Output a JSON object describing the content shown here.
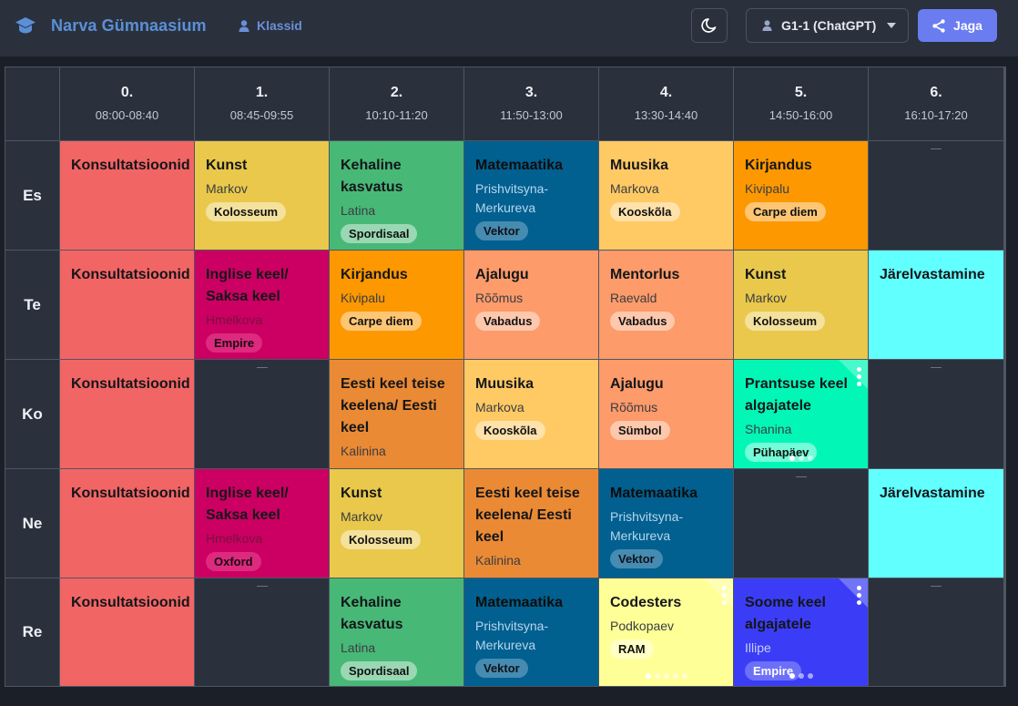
{
  "header": {
    "title": "Narva Gümnaasium",
    "classes_link": "Klassid",
    "class_select": "G1-1 (ChatGPT)",
    "share_label": "Jaga",
    "icons": [
      "school-icon",
      "user-icon",
      "moon-icon",
      "chevron-down-icon",
      "share-icon"
    ]
  },
  "periods": [
    {
      "num": "0.",
      "time": "08:00-08:40"
    },
    {
      "num": "1.",
      "time": "08:45-09:55"
    },
    {
      "num": "2.",
      "time": "10:10-11:20"
    },
    {
      "num": "3.",
      "time": "11:50-13:00"
    },
    {
      "num": "4.",
      "time": "13:30-14:40"
    },
    {
      "num": "5.",
      "time": "14:50-16:00"
    },
    {
      "num": "6.",
      "time": "16:10-17:20"
    }
  ],
  "days": [
    "Es",
    "Te",
    "Ko",
    "Ne",
    "Re"
  ],
  "colors": {
    "red": "#f26565",
    "yellow": "#e9c84b",
    "green": "#48b877",
    "darkblue": "#01608f",
    "lightorange": "#ffc964",
    "orange": "#fd9800",
    "magenta": "#cb0062",
    "salmon": "#fd9b6a",
    "deeporange": "#eb8a34",
    "cyan": "#62ffff",
    "mint": "#02f7b7",
    "paleyellow": "#ffff98",
    "violet": "#3b3df6"
  },
  "schedule": [
    [
      {
        "subject": "Konsultatsioonid",
        "color": "red"
      },
      {
        "subject": "Kunst",
        "teacher": "Markov",
        "room": "Kolosseum",
        "color": "yellow"
      },
      {
        "subject": "Kehaline kasvatus",
        "teacher": "Latina",
        "room": "Spordisaal",
        "color": "green"
      },
      {
        "subject": "Matemaatika",
        "teacher": "Prishvitsyna-Merkureva",
        "room": "Vektor",
        "color": "darkblue"
      },
      {
        "subject": "Muusika",
        "teacher": "Markova",
        "room": "Kooskõla",
        "color": "lightorange"
      },
      {
        "subject": "Kirjandus",
        "teacher": "Kivipalu",
        "room": "Carpe diem",
        "color": "orange"
      },
      null
    ],
    [
      {
        "subject": "Konsultatsioonid",
        "color": "red"
      },
      {
        "subject": "Inglise keel/ Saksa keel",
        "teacher": "Hmelkova",
        "room": "Empire",
        "color": "magenta"
      },
      {
        "subject": "Kirjandus",
        "teacher": "Kivipalu",
        "room": "Carpe diem",
        "color": "orange"
      },
      {
        "subject": "Ajalugu",
        "teacher": "Rõõmus",
        "room": "Vabadus",
        "color": "salmon"
      },
      {
        "subject": "Mentorlus",
        "teacher": "Raevald",
        "room": "Vabadus",
        "color": "salmon"
      },
      {
        "subject": "Kunst",
        "teacher": "Markov",
        "room": "Kolosseum",
        "color": "yellow"
      },
      {
        "subject": "Järelvastamine",
        "color": "cyan"
      }
    ],
    [
      {
        "subject": "Konsultatsioonid",
        "color": "red"
      },
      null,
      {
        "subject": "Eesti keel teise keelena/ Eesti keel",
        "teacher": "Kalinina",
        "color": "deeporange"
      },
      {
        "subject": "Muusika",
        "teacher": "Markova",
        "room": "Kooskõla",
        "color": "lightorange"
      },
      {
        "subject": "Ajalugu",
        "teacher": "Rõõmus",
        "room": "Sümbol",
        "color": "salmon"
      },
      {
        "subject": "Prantsuse keel algajatele",
        "teacher": "Shanina",
        "room": "Pühapäev",
        "color": "mint",
        "multi": 3
      },
      null
    ],
    [
      {
        "subject": "Konsultatsioonid",
        "color": "red"
      },
      {
        "subject": "Inglise keel/ Saksa keel",
        "teacher": "Hmelkova",
        "room": "Oxford",
        "color": "magenta"
      },
      {
        "subject": "Kunst",
        "teacher": "Markov",
        "room": "Kolosseum",
        "color": "yellow"
      },
      {
        "subject": "Eesti keel teise keelena/ Eesti keel",
        "teacher": "Kalinina",
        "color": "deeporange"
      },
      {
        "subject": "Matemaatika",
        "teacher": "Prishvitsyna-Merkureva",
        "room": "Vektor",
        "color": "darkblue"
      },
      null,
      {
        "subject": "Järelvastamine",
        "color": "cyan"
      }
    ],
    [
      {
        "subject": "Konsultatsioonid",
        "color": "red"
      },
      null,
      {
        "subject": "Kehaline kasvatus",
        "teacher": "Latina",
        "room": "Spordisaal",
        "color": "green"
      },
      {
        "subject": "Matemaatika",
        "teacher": "Prishvitsyna-Merkureva",
        "room": "Vektor",
        "color": "darkblue"
      },
      {
        "subject": "Codesters",
        "teacher": "Podkopaev",
        "room": "RAM",
        "color": "paleyellow",
        "multi": 5
      },
      {
        "subject": "Soome keel algajatele",
        "teacher": "Illipe",
        "room": "Empire",
        "color": "violet",
        "multi": 3
      },
      null
    ]
  ]
}
